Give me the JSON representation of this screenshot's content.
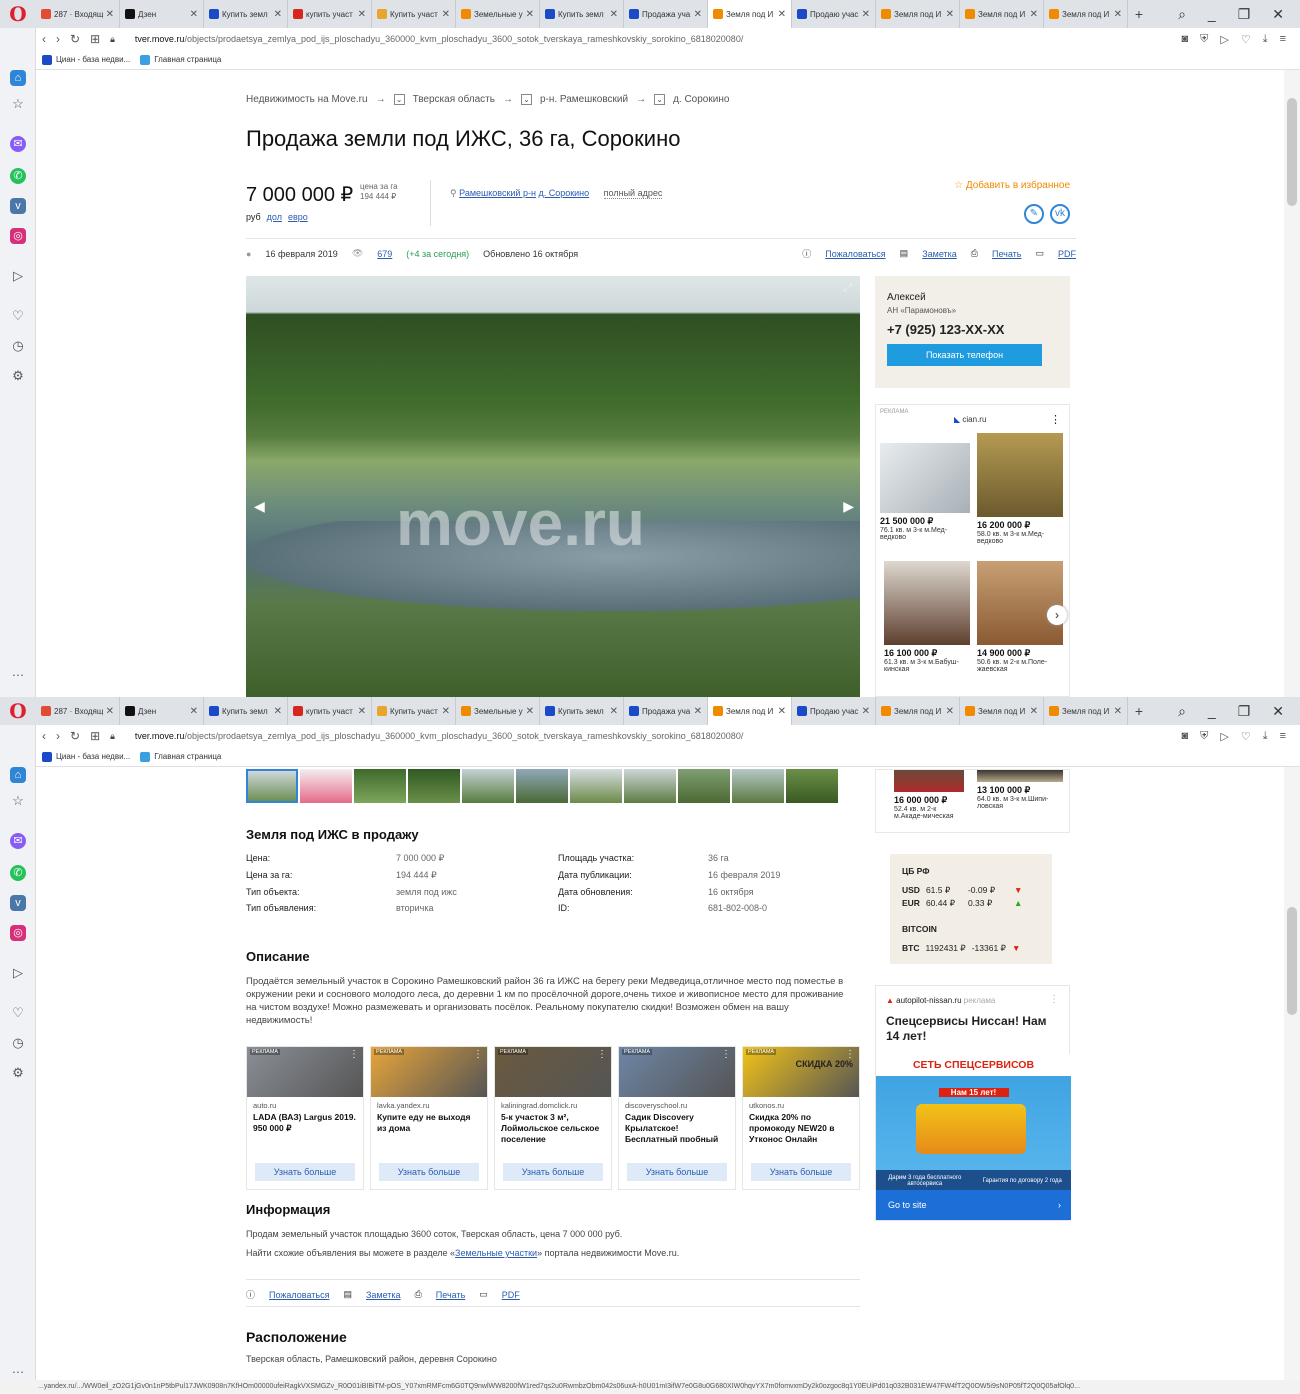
{
  "browser": {
    "logo": "O",
    "tabs": [
      {
        "label": "287 · Входящ",
        "color": "#e34b34"
      },
      {
        "label": "Дзен",
        "color": "#111"
      },
      {
        "label": "Купить земл",
        "color": "#1a4ac8"
      },
      {
        "label": "купить участ",
        "color": "#d9261c"
      },
      {
        "label": "Купить участ",
        "color": "#e8a52e"
      },
      {
        "label": "Земельные у",
        "color": "#f08a00"
      },
      {
        "label": "Купить земл",
        "color": "#1a4ac8"
      },
      {
        "label": "Продажа уча",
        "color": "#1a4ac8"
      },
      {
        "label": "Земля под И",
        "color": "#f08a00",
        "active": true
      },
      {
        "label": "Продаю учас",
        "color": "#1a4ac8"
      },
      {
        "label": "Земля под И",
        "color": "#f08a00"
      },
      {
        "label": "Земля под И",
        "color": "#f08a00"
      },
      {
        "label": "Земля под И",
        "color": "#f08a00"
      }
    ],
    "url_host": "tver.move.ru",
    "url_path": "/objects/prodaetsya_zemlya_pod_ijs_ploschadyu_360000_kvm_ploschadyu_3600_sotok_tverskaya_rameshkovskiy_sorokino_6818020080/",
    "bookmarks": [
      "Циан - база недви...",
      "Главная страница"
    ],
    "status_url": "...yandex.ru/.../WW0eil_zO2G1jGv0n1nP5tbPul17JWK0908n7KfHOm00000ufeiRagkVXSMGZv_R0O01iBIBiTM-pOS_Y07xmRMFcm6G0TQ9nwlWW8200fW1red7qs2u0RwmbzObm042s06uxA-h0U01mI3ifW7e0G8u0G680XIW0hqvYX7m0fomvxmDy2k0ozgoc8q1Y0EUiPd01q032B031EW47FW4fT2Q0OW5i9sN0P05fT2Q0Q05afOlq0..."
  },
  "breadcrumbs": [
    "Недвижимость на Move.ru",
    "Тверская область",
    "р-н. Рамешковский",
    "д. Сорокино"
  ],
  "title": "Продажа земли под ИЖС, 36 га, Сорокино",
  "price": {
    "value": "7 000 000 ₽",
    "per_label": "цена за га",
    "per_value": "194 444 ₽",
    "currencies": [
      "руб",
      "дол",
      "евро"
    ]
  },
  "location": {
    "district": "Рамешковский р-н",
    "village": "д. Сорокино",
    "full_address": "полный адрес"
  },
  "favorite": "Добавить в избранное",
  "meta": {
    "date": "16 февраля 2019",
    "views": "679",
    "views_today": "(+4 за сегодня)",
    "updated": "Обновлено 16 октября",
    "complain": "Пожаловаться",
    "note": "Заметка",
    "print": "Печать",
    "pdf": "PDF"
  },
  "watermark": "move.ru",
  "agent": {
    "name": "Алексей",
    "agency": "АН «Парамоновъ»",
    "phone": "+7 (925) 123-XX-XX",
    "button": "Показать телефон"
  },
  "cian_ad": {
    "label": "РЕКЛАМА",
    "source": "cian.ru",
    "cards": [
      {
        "price": "21 500 000 ₽",
        "desc": "76.1 кв. м 3-к м.Мед-ведково"
      },
      {
        "price": "16 200 000 ₽",
        "desc": "58.0 кв. м 3-к м.Мед-ведково"
      },
      {
        "price": "16 100 000 ₽",
        "desc": "61.3 кв. м 3-к м.Бабуш-кинская"
      },
      {
        "price": "14 900 000 ₽",
        "desc": "50.6 кв. м 2-к м.Поле-жаевская"
      },
      {
        "price": "16 000 000 ₽",
        "desc": "52.4 кв. м 2-к м.Акаде-мическая"
      },
      {
        "price": "13 100 000 ₽",
        "desc": "64.0 кв. м 3-к м.Шипи-ловская"
      }
    ]
  },
  "details": {
    "heading": "Земля под ИЖС в продажу",
    "rows": [
      [
        "Цена:",
        "7 000 000 ₽",
        "Площадь участка:",
        "36 га"
      ],
      [
        "Цена за га:",
        "194 444 ₽",
        "Дата публикации:",
        "16 февраля 2019"
      ],
      [
        "Тип объекта:",
        "земля под ижс",
        "Дата обновления:",
        "16 октября"
      ],
      [
        "Тип объявления:",
        "вторичка",
        "ID:",
        "681-802-008-0"
      ]
    ]
  },
  "description": {
    "heading": "Описание",
    "text": "Продаётся земельный участок в Сорокино Рамешковский район 36 га ИЖС на берегу реки Медведица,отличное место под поместье в окружении реки и соснового молодого леса, до деревни 1 км по просёлочной дороге,очень тихое и живописное место для проживание на чистом воздухе! Можно размежевать и организовать посёлок. Реальному покупателю скидки! Возможен обмен на вашу недвижимость!"
  },
  "ads": [
    {
      "label": "РЕКЛАМА",
      "src": "auto.ru",
      "title": "LADA (ВАЗ) Largus 2019. 950 000 ₽",
      "btn": "Узнать больше",
      "color": "#8a8f96"
    },
    {
      "label": "РЕКЛАМА",
      "src": "lavka.yandex.ru",
      "title": "Купите еду не выходя из дома",
      "btn": "Узнать больше",
      "color": "#e7a53a"
    },
    {
      "label": "РЕКЛАМА",
      "src": "kaliningrad.domclick.ru",
      "title": "5-к участок 3 м², Лоймольское сельское поселение",
      "btn": "Узнать больше",
      "color": "#6b5a3e"
    },
    {
      "label": "РЕКЛАМА",
      "src": "discoveryschool.ru",
      "title": "Садик Discovery Крылатское! Бесплатный пробный день",
      "btn": "Узнать больше",
      "color": "#6d86a6"
    },
    {
      "label": "РЕКЛАМА",
      "src": "utkonos.ru",
      "title": "Скидка 20% по промокоду NEW20 в Утконос Онлайн",
      "btn": "Узнать больше",
      "color": "#f2c318",
      "banner": "СКИДКА 20%"
    }
  ],
  "info": {
    "heading": "Информация",
    "line1": "Продам земельный участок площадью 3600 соток, Тверская область, цена 7 000 000 руб.",
    "line2_pre": "Найти схожие объявления вы можете в разделе «",
    "line2_link": "Земельные участки",
    "line2_post": "» портала недвижимости Move.ru."
  },
  "location_section": {
    "heading": "Расположение",
    "text": "Тверская область, Рамешковский район, деревня Сорокино"
  },
  "rates": {
    "cb_title": "ЦБ РФ",
    "usd": [
      "USD",
      "61.5 ₽",
      "-0.09 ₽"
    ],
    "eur": [
      "EUR",
      "60.44 ₽",
      "0.33 ₽"
    ],
    "btc_title": "BITCOIN",
    "btc": [
      "BTC",
      "1192431 ₽",
      "-13361 ₽"
    ]
  },
  "nissan_ad": {
    "src": "autopilot-nissan.ru",
    "label": "реклама",
    "title": "Спецсервисы Ниссан! Нам 14 лет!",
    "banner": "СЕТЬ СПЕЦСЕРВИСОВ",
    "sub": "Нам 15 лет!",
    "left_note": "Дарим 3 года бесплатного автосервиса",
    "right_note": "Гарантия по договору 2 года",
    "cta": "Go to site"
  }
}
